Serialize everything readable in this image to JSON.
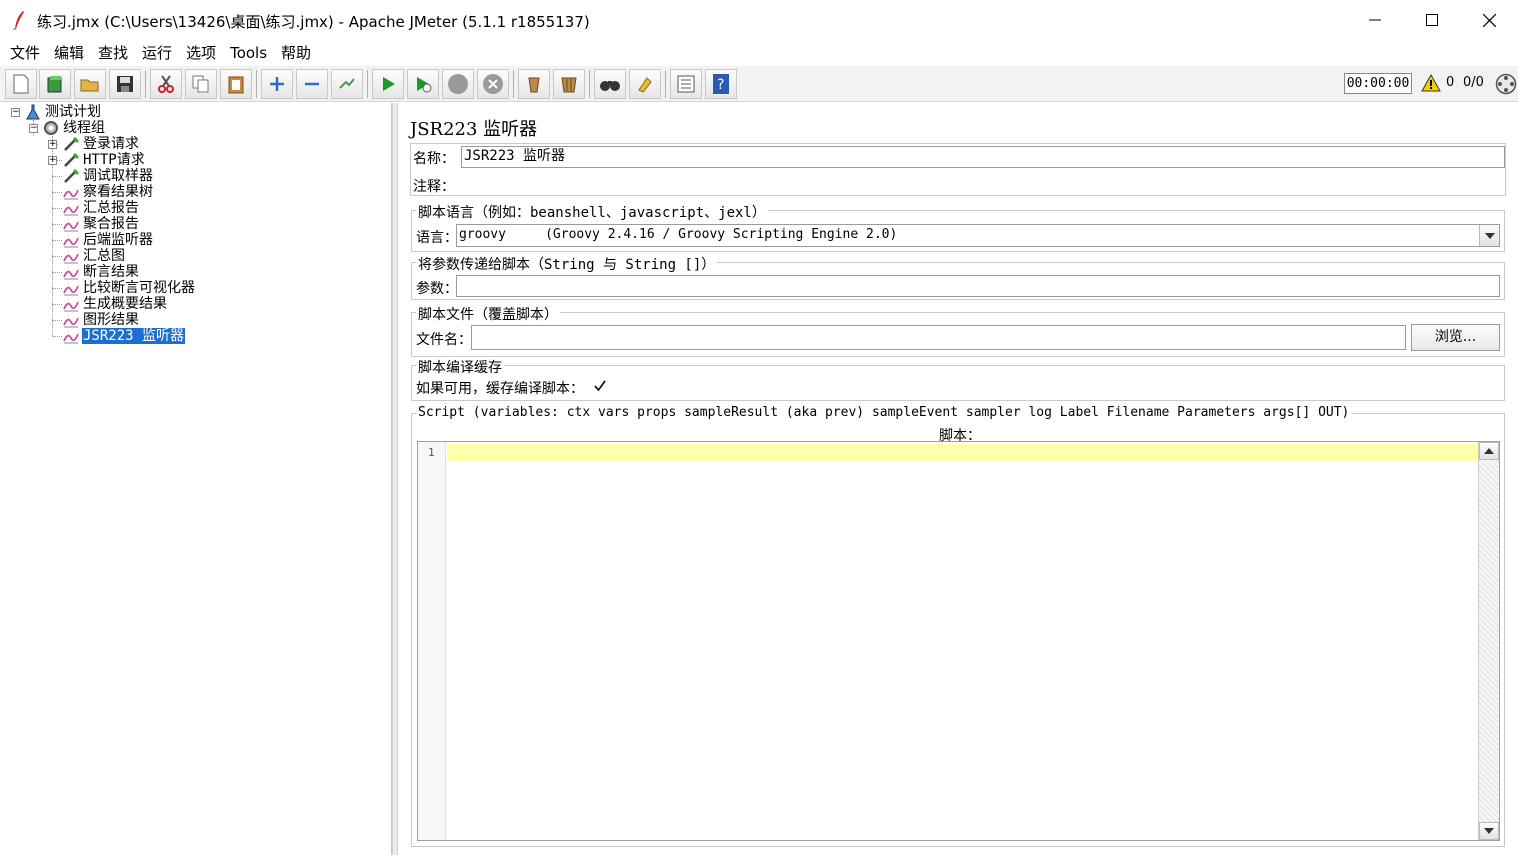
{
  "window": {
    "title": "练习.jmx (C:\\Users\\13426\\桌面\\练习.jmx) - Apache JMeter (5.1.1 r1855137)"
  },
  "menu": [
    "文件",
    "编辑",
    "查找",
    "运行",
    "选项",
    "Tools",
    "帮助"
  ],
  "toolbar": {
    "icons": [
      "new-icon",
      "templates-icon",
      "open-icon",
      "save-icon",
      "cut-icon",
      "copy-icon",
      "paste-icon",
      "expand-icon",
      "collapse-icon",
      "toggle-icon",
      "start-icon",
      "start-no-pause-icon",
      "stop-icon",
      "shutdown-icon",
      "clear-icon",
      "clear-all-icon",
      "search-icon",
      "reset-search-icon",
      "function-helper-icon",
      "help-icon"
    ],
    "timer": "00:00:00",
    "warning_count": "0",
    "threads": "0/0"
  },
  "tree": {
    "items": [
      {
        "label": "测试计划",
        "icon": "test-plan-icon",
        "level": 0,
        "expander": "−"
      },
      {
        "label": "线程组",
        "icon": "thread-group-icon",
        "level": 1,
        "expander": "−"
      },
      {
        "label": "登录请求",
        "icon": "sampler-icon",
        "level": 2,
        "expander": "+"
      },
      {
        "label": "HTTP请求",
        "icon": "sampler-icon",
        "level": 2,
        "expander": "+"
      },
      {
        "label": "调试取样器",
        "icon": "sampler-icon",
        "level": 2,
        "expander": ""
      },
      {
        "label": "察看结果树",
        "icon": "listener-icon",
        "level": 2,
        "expander": ""
      },
      {
        "label": "汇总报告",
        "icon": "listener-icon",
        "level": 2,
        "expander": ""
      },
      {
        "label": "聚合报告",
        "icon": "listener-icon",
        "level": 2,
        "expander": ""
      },
      {
        "label": "后端监听器",
        "icon": "listener-icon",
        "level": 2,
        "expander": ""
      },
      {
        "label": "汇总图",
        "icon": "listener-icon",
        "level": 2,
        "expander": ""
      },
      {
        "label": "断言结果",
        "icon": "listener-icon",
        "level": 2,
        "expander": ""
      },
      {
        "label": "比较断言可视化器",
        "icon": "listener-icon",
        "level": 2,
        "expander": ""
      },
      {
        "label": "生成概要结果",
        "icon": "listener-icon",
        "level": 2,
        "expander": ""
      },
      {
        "label": "图形结果",
        "icon": "listener-icon",
        "level": 2,
        "expander": ""
      },
      {
        "label": "JSR223 监听器",
        "icon": "listener-icon",
        "level": 2,
        "expander": "",
        "selected": true
      }
    ]
  },
  "panel": {
    "title": "JSR223 监听器",
    "name_label": "名称：",
    "name_value": "JSR223 监听器",
    "comment_label": "注释：",
    "comment_value": "",
    "lang_group": "脚本语言（例如：beanshell、javascript、jexl）",
    "lang_label": "语言：",
    "lang_value": "groovy     (Groovy 2.4.16 / Groovy Scripting Engine 2.0)",
    "params_group": "将参数传递给脚本（String 与 String []）",
    "params_label": "参数：",
    "params_value": "",
    "file_group": "脚本文件（覆盖脚本）",
    "file_label": "文件名：",
    "file_value": "",
    "browse_label": "浏览...",
    "cache_group": "脚本编译缓存",
    "cache_label": "如果可用，缓存编译脚本：",
    "cache_checked": true,
    "script_group": "Script (variables: ctx vars props sampleResult (aka prev) sampleEvent sampler log Label Filename Parameters args[] OUT)",
    "script_label": "脚本：",
    "line_number": "1",
    "script_content": ""
  }
}
